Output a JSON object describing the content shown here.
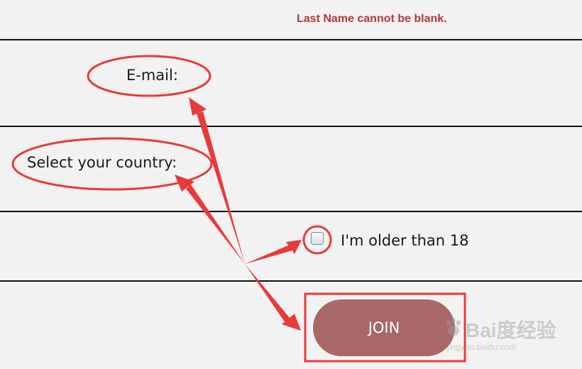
{
  "form": {
    "error_message": "Last Name cannot be blank.",
    "email_label": "E-mail:",
    "country_label": "Select your country:",
    "age_checkbox_label": "I'm older than 18",
    "age_checkbox_checked": false,
    "join_button_label": "JOIN"
  },
  "annotations": {
    "color": "#e83a3a"
  },
  "watermark": {
    "main": "Bai度经验",
    "sub": "jingyan.baidu.com"
  }
}
